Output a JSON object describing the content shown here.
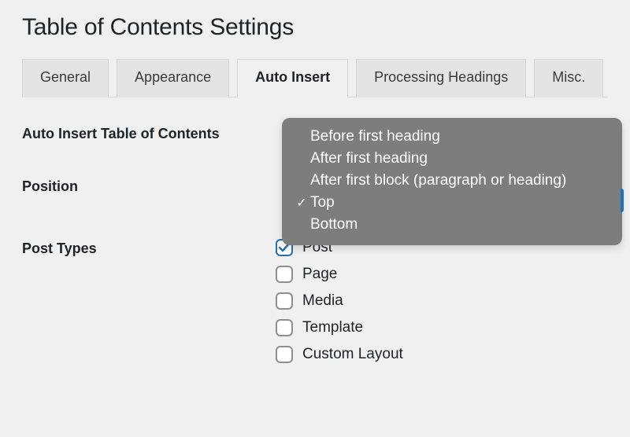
{
  "header": {
    "title": "Table of Contents Settings"
  },
  "tabs": [
    {
      "label": "General",
      "active": false
    },
    {
      "label": "Appearance",
      "active": false
    },
    {
      "label": "Auto Insert",
      "active": true
    },
    {
      "label": "Processing Headings",
      "active": false
    },
    {
      "label": "Misc.",
      "active": false
    }
  ],
  "fields": {
    "auto_insert_label": "Auto Insert Table of Contents",
    "position_label": "Position",
    "post_types_label": "Post Types"
  },
  "position_options": [
    {
      "label": "Before first heading",
      "selected": false
    },
    {
      "label": "After first heading",
      "selected": false
    },
    {
      "label": "After first block (paragraph or heading)",
      "selected": false
    },
    {
      "label": "Top",
      "selected": true
    },
    {
      "label": "Bottom",
      "selected": false
    }
  ],
  "post_types": [
    {
      "label": "Post",
      "checked": true
    },
    {
      "label": "Page",
      "checked": false
    },
    {
      "label": "Media",
      "checked": false
    },
    {
      "label": "Template",
      "checked": false
    },
    {
      "label": "Custom Layout",
      "checked": false
    }
  ]
}
